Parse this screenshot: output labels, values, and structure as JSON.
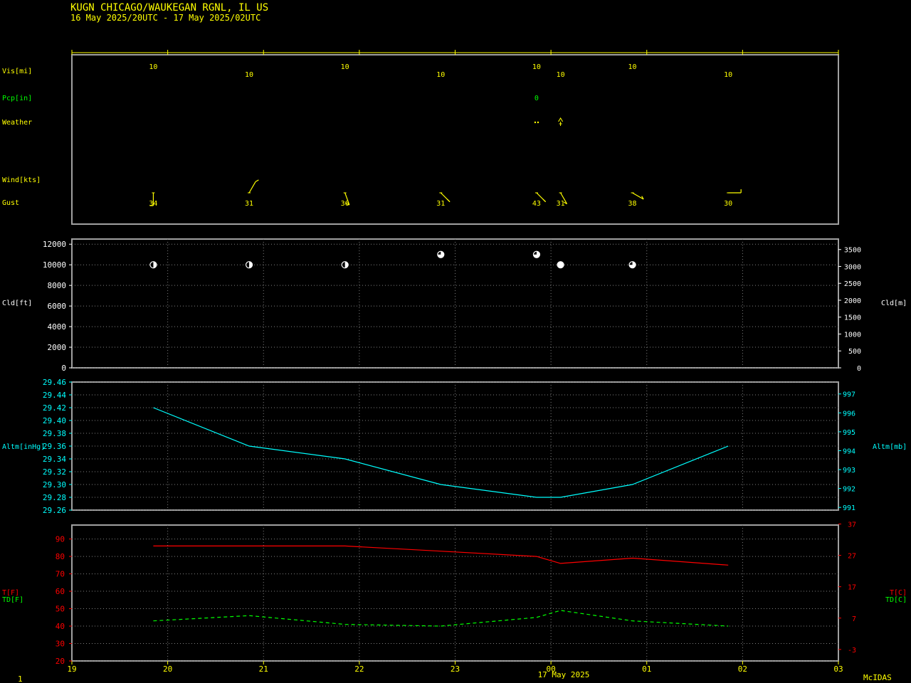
{
  "header": {
    "station": "KUGN  CHICAGO/WAUKEGAN RGNL, IL US",
    "period": "16 May 2025/20UTC - 17 May 2025/02UTC"
  },
  "footer": {
    "page_number": "1",
    "date_label": "17 May 2025",
    "brand": "McIDAS"
  },
  "colors": {
    "yellow": "#ffff00",
    "green": "#00ff00",
    "white": "#ffffff",
    "cyan": "#00ffff",
    "red": "#ff0000",
    "frame": "#a0a0a0",
    "grid": "#808080"
  },
  "x_axis": {
    "range_hours": [
      19,
      27
    ],
    "tick_labels": [
      "19",
      "20",
      "21",
      "22",
      "23",
      "00",
      "01",
      "02",
      "03"
    ]
  },
  "obs_hours": [
    19.85,
    20.85,
    21.85,
    22.85,
    23.85,
    24.1,
    24.85,
    25.85
  ],
  "chart_data": [
    {
      "type": "table",
      "rows": {
        "visibility": {
          "label": "Vis[mi]",
          "values": [
            "10",
            "10",
            "10",
            "10",
            "10",
            "10",
            "10",
            "10"
          ],
          "stagger": [
            0,
            1,
            0,
            1,
            0,
            1,
            0,
            1
          ]
        },
        "precip": {
          "label": "Pcp[in]",
          "entries": [
            {
              "obs": 4,
              "value": "0"
            }
          ]
        },
        "weather": {
          "label": "Weather",
          "entries": [
            {
              "obs": 4,
              "symbol": "rain-dots"
            },
            {
              "obs": 5,
              "symbol": "thunder"
            }
          ]
        },
        "wind": {
          "label": "Wind[kts]",
          "barb_angles_deg": [
            180,
            330,
            200,
            225,
            225,
            210,
            240,
            270
          ]
        },
        "gust": {
          "label": "Gust",
          "values": [
            "34",
            "31",
            "36",
            "31",
            "43",
            "31",
            "38",
            "30"
          ]
        }
      }
    },
    {
      "type": "scatter",
      "y_label_left": "Cld[ft]",
      "y_label_right": "Cld[m]",
      "ylim_ft": [
        0,
        12500
      ],
      "left_ticks": [
        "0",
        "2000",
        "4000",
        "6000",
        "8000",
        "10000",
        "12000"
      ],
      "right_ticks": [
        "0",
        "500",
        "1000",
        "1500",
        "2000",
        "2500",
        "3000",
        "3500"
      ],
      "cloud_bases_ft": [
        10000,
        10000,
        10000,
        11000,
        11000,
        10000,
        10000
      ],
      "cloud_cover_fraction": [
        0.5,
        0.5,
        0.5,
        0.75,
        0.75,
        1.0,
        0.75
      ]
    },
    {
      "type": "line",
      "y_label_left": "Altm[inHg]",
      "y_label_right": "Altm[mb]",
      "ylim_inhg": [
        29.26,
        29.46
      ],
      "left_ticks": [
        "29.26",
        "29.28",
        "29.30",
        "29.32",
        "29.34",
        "29.36",
        "29.38",
        "29.40",
        "29.42",
        "29.44",
        "29.46"
      ],
      "right_ticks": [
        "991",
        "992",
        "993",
        "994",
        "995",
        "996",
        "997"
      ],
      "series": [
        {
          "values": [
            29.42,
            29.36,
            29.34,
            29.3,
            29.28,
            29.28,
            29.3,
            29.36
          ],
          "color": "#00ffff"
        }
      ]
    },
    {
      "type": "line",
      "y_label_left": "T[F]",
      "y_label_left_2": "TD[F]",
      "y_label_right": "T[C]",
      "y_label_right_2": "TD[C]",
      "ylim_f": [
        20,
        98
      ],
      "left_ticks": [
        "20",
        "30",
        "40",
        "50",
        "60",
        "70",
        "80",
        "90"
      ],
      "right_ticks": [
        "-3",
        "7",
        "17",
        "27",
        "37"
      ],
      "series": [
        {
          "values": [
            86,
            86,
            86,
            83,
            80,
            76,
            79,
            75
          ],
          "color": "#ff0000",
          "style": "solid"
        },
        {
          "values": [
            43,
            46,
            41,
            40,
            45,
            49,
            43,
            40
          ],
          "color": "#00ff00",
          "style": "dashed"
        }
      ]
    }
  ]
}
